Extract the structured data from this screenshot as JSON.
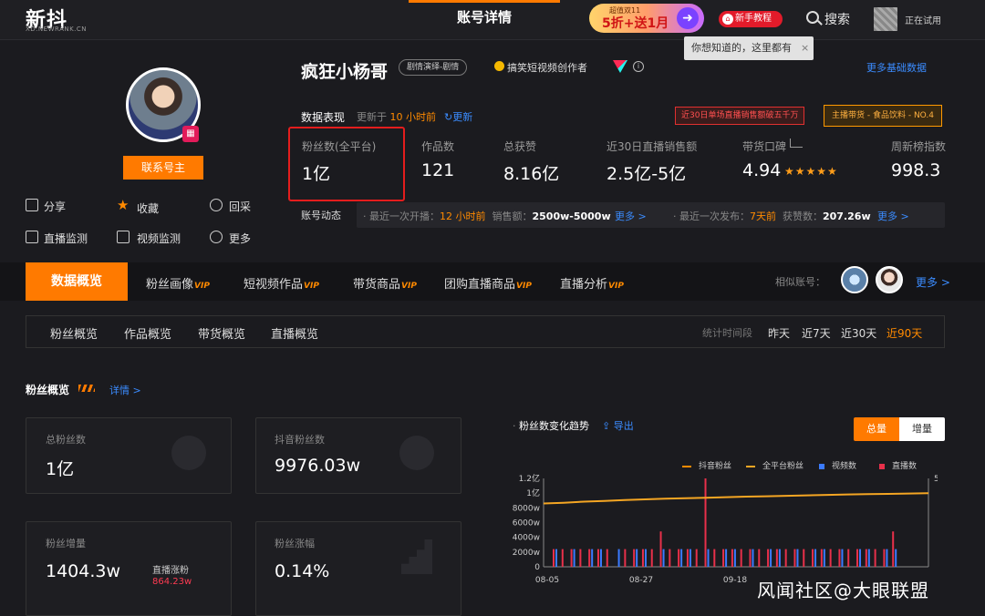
{
  "header": {
    "logo": "新抖",
    "logo_sub": "XD.NEWRANK.CN",
    "page_title": "账号详情",
    "promo_line1": "超值双11",
    "promo_line2": "5折+送1月",
    "newbie_label": "新手教程",
    "search_label": "搜索",
    "user_status": "正在试用",
    "tooltip": "你想知道的，这里都有",
    "tooltip_close": "×"
  },
  "profile": {
    "contact_label": "联系号主",
    "actions": [
      "分享",
      "收藏",
      "回采",
      "直播监测",
      "视频监测",
      "更多"
    ],
    "name": "疯狂小杨哥",
    "tag": "剧情演绎-剧情",
    "cert": "搞笑短视频创作者",
    "more_basic": "更多基础数据"
  },
  "performance": {
    "label": "数据表现",
    "updated_prefix": "更新于",
    "updated_value": "10 小时前",
    "refresh_label": "更新",
    "badge_red": "近30日单场直播销售额破五千万",
    "badge_orange": "主播带货 - 食品饮料 - NO.4",
    "stats": [
      {
        "label": "粉丝数(全平台)",
        "value": "1亿"
      },
      {
        "label": "作品数",
        "value": "121"
      },
      {
        "label": "总获赞",
        "value": "8.16亿"
      },
      {
        "label": "近30日直播销售额",
        "value": "2.5亿-5亿"
      },
      {
        "label": "带货口碑",
        "value": "4.94",
        "stars": "★★★★★"
      },
      {
        "label": "周新榜指数",
        "value": "998.3"
      }
    ]
  },
  "dynamics": {
    "label": "账号动态",
    "live_prefix": "最近一次开播：",
    "live_time": "12 小时前",
    "sales_prefix": "销售额：",
    "sales_value": "2500w-5000w",
    "more1": "更多 >",
    "post_prefix": "最近一次发布：",
    "post_time": "7天前",
    "likes_prefix": "获赞数：",
    "likes_value": "207.26w",
    "more2": "更多 >"
  },
  "tabs": {
    "active": "数据概览",
    "items": [
      {
        "label": "粉丝画像",
        "vip": "VIP"
      },
      {
        "label": "短视频作品",
        "vip": "VIP"
      },
      {
        "label": "带货商品",
        "vip": "VIP"
      },
      {
        "label": "团购直播商品",
        "vip": "VIP"
      },
      {
        "label": "直播分析",
        "vip": "VIP"
      }
    ],
    "similar_label": "相似账号：",
    "more_label": "更多 >"
  },
  "subtabs": {
    "items": [
      "粉丝概览",
      "作品概览",
      "带货概览",
      "直播概览"
    ],
    "period_label": "统计时间段",
    "periods": [
      "昨天",
      "近7天",
      "近30天",
      "近90天"
    ],
    "period_active": "近90天"
  },
  "overview": {
    "title": "粉丝概览",
    "detail_link": "详情 >",
    "cards": {
      "total_fans": {
        "label": "总粉丝数",
        "value": "1亿"
      },
      "douyin_fans": {
        "label": "抖音粉丝数",
        "value": "9976.03w"
      },
      "fan_growth": {
        "label": "粉丝增量",
        "value": "1404.3w",
        "sub_label": "直播涨粉",
        "sub_value": "864.23w"
      },
      "growth_rate": {
        "label": "粉丝涨幅",
        "value": "0.14%"
      }
    }
  },
  "chart_header": {
    "title": "粉丝数变化趋势",
    "export_label": "导出",
    "seg_total": "总量",
    "seg_increment": "增量"
  },
  "chart_data": {
    "type": "line",
    "title": "粉丝数变化趋势",
    "x_ticks": [
      "08-05",
      "08-27",
      "09-18"
    ],
    "y_ticks": [
      "0",
      "2000w",
      "4000w",
      "6000w",
      "8000w",
      "1亿",
      "1.2亿"
    ],
    "ylim": [
      0,
      12000
    ],
    "y2_ticks": [
      "5"
    ],
    "y2lim": [
      0,
      5
    ],
    "colors": {
      "douyin": "#ff8a00",
      "all": "#f5a623",
      "video": "#3b7bff",
      "live": "#e8304a"
    },
    "legend": [
      "抖音粉丝",
      "全平台粉丝",
      "视频数",
      "直播数"
    ],
    "legend_position": "top-right",
    "series": [
      {
        "name": "全平台粉丝",
        "kind": "line",
        "values": [
          8600,
          8700,
          8850,
          8950,
          9050,
          9150,
          9250,
          9300,
          9380,
          9450,
          9520,
          9580,
          9640,
          9700,
          9760,
          9820,
          9870,
          9900,
          9950,
          10000
        ]
      },
      {
        "name": "直播数",
        "kind": "bar",
        "values": [
          1,
          1,
          1,
          1,
          1,
          1,
          1,
          0,
          1,
          1,
          1,
          1,
          2,
          1,
          1,
          1,
          1,
          5,
          1,
          1,
          1,
          1,
          1,
          1,
          1,
          1,
          1,
          1,
          1,
          1,
          1,
          1,
          1,
          1,
          1,
          1,
          1,
          1,
          2
        ]
      },
      {
        "name": "视频数",
        "kind": "bar",
        "values": [
          1,
          0,
          1,
          0,
          1,
          1,
          0,
          1,
          0,
          1,
          1,
          0,
          1,
          0,
          1,
          1,
          0,
          1,
          0,
          1,
          1,
          0,
          1,
          0,
          1,
          1,
          0,
          1,
          0,
          1,
          1,
          0,
          1,
          0,
          1,
          1,
          0,
          1,
          1
        ]
      }
    ]
  },
  "watermark": "风闻社区@大眼联盟"
}
